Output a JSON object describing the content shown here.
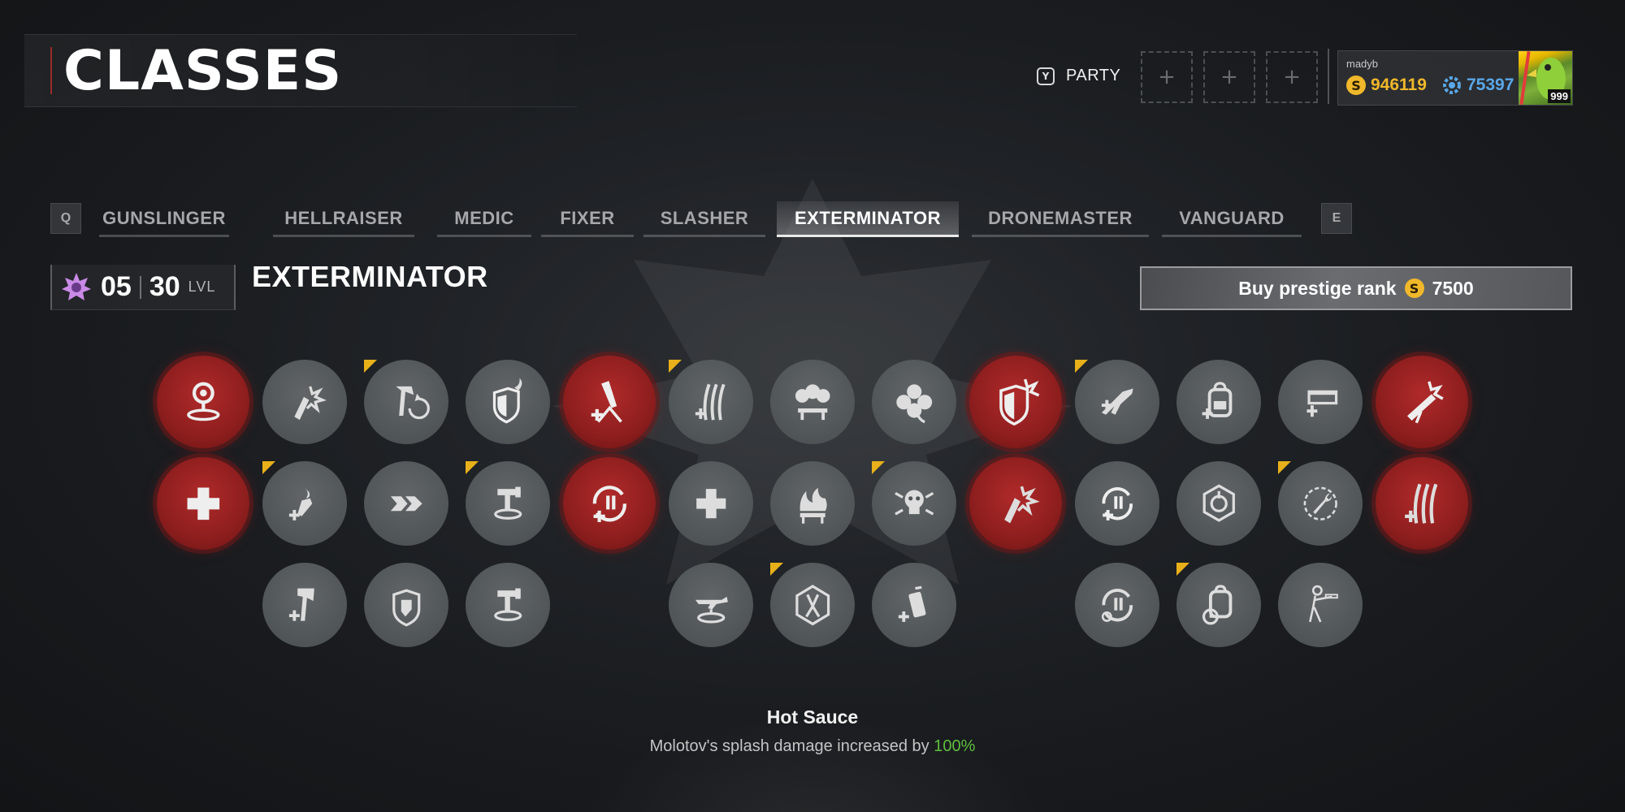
{
  "page": {
    "title": "CLASSES"
  },
  "party": {
    "key": "Y",
    "label": "PARTY",
    "slots": [
      "+",
      "+",
      "+"
    ]
  },
  "profile": {
    "username": "madyb",
    "credits": "946119",
    "tokens": "75397",
    "level": "999",
    "credits_color": "#f0b82a",
    "tokens_color": "#5aa7e8"
  },
  "tabs": {
    "prev_key": "Q",
    "next_key": "E",
    "items": [
      "GUNSLINGER",
      "HELLRAISER",
      "MEDIC",
      "FIXER",
      "SLASHER",
      "EXTERMINATOR",
      "DRONEMASTER",
      "VANGUARD"
    ],
    "active": "EXTERMINATOR"
  },
  "class_header": {
    "rank": "05",
    "level": "30",
    "level_label": "LVL",
    "name": "EXTERMINATOR"
  },
  "prestige": {
    "label": "Buy prestige rank",
    "cost": "7500"
  },
  "skills": {
    "rows": [
      [
        {
          "icon": "target-pin-icon",
          "state": "selected"
        },
        {
          "icon": "molotov-burst-icon",
          "state": "available"
        },
        {
          "icon": "axe-refresh-icon",
          "state": "available",
          "new": true
        },
        {
          "icon": "shield-flame-icon",
          "state": "available"
        },
        {
          "icon": "mortar-plus-icon",
          "state": "selected"
        },
        {
          "icon": "claw-plus-icon",
          "state": "available",
          "new": true
        },
        {
          "icon": "triple-skull-icon",
          "state": "available"
        },
        {
          "icon": "clover-icon",
          "state": "available"
        },
        {
          "icon": "shield-burst-icon",
          "state": "selected"
        },
        {
          "icon": "rifle-plus-icon",
          "state": "available",
          "new": true
        },
        {
          "icon": "backpack-plus-icon",
          "state": "available"
        },
        {
          "icon": "ammo-box-plus-icon",
          "state": "available"
        },
        {
          "icon": "launcher-burst-icon",
          "state": "selected"
        }
      ],
      [
        {
          "icon": "medkit-icon",
          "state": "selected"
        },
        {
          "icon": "torch-plus-icon",
          "state": "available",
          "new": true
        },
        {
          "icon": "chevrons-icon",
          "state": "available"
        },
        {
          "icon": "turret-icon",
          "state": "available",
          "new": true
        },
        {
          "icon": "reload-plus-icon",
          "state": "selected"
        },
        {
          "icon": "cross-icon",
          "state": "available"
        },
        {
          "icon": "fire-pit-icon",
          "state": "available"
        },
        {
          "icon": "skull-burst-icon",
          "state": "available",
          "new": true
        },
        {
          "icon": "molotov-burst-icon",
          "state": "selected"
        },
        {
          "icon": "reload-plus-icon",
          "state": "available"
        },
        {
          "icon": "hex-target-icon",
          "state": "available"
        },
        {
          "icon": "wrench-cycle-icon",
          "state": "available",
          "new": true
        },
        {
          "icon": "claw-plus-icon",
          "state": "selected"
        }
      ],
      [
        null,
        {
          "icon": "axe-plus-icon",
          "state": "available"
        },
        {
          "icon": "shield-hand-icon",
          "state": "available"
        },
        {
          "icon": "turret-icon",
          "state": "available"
        },
        null,
        {
          "icon": "rifle-drop-icon",
          "state": "available"
        },
        {
          "icon": "hex-pliers-icon",
          "state": "available",
          "new": true
        },
        {
          "icon": "canister-plus-icon",
          "state": "available"
        },
        null,
        {
          "icon": "reload-target-icon",
          "state": "available"
        },
        {
          "icon": "backpack-timer-icon",
          "state": "available",
          "new": true
        },
        {
          "icon": "soldier-aim-icon",
          "state": "available"
        },
        null
      ]
    ]
  },
  "tooltip": {
    "name": "Hot Sauce",
    "desc_prefix": "Molotov's splash damage increased by ",
    "desc_value": "100%"
  }
}
